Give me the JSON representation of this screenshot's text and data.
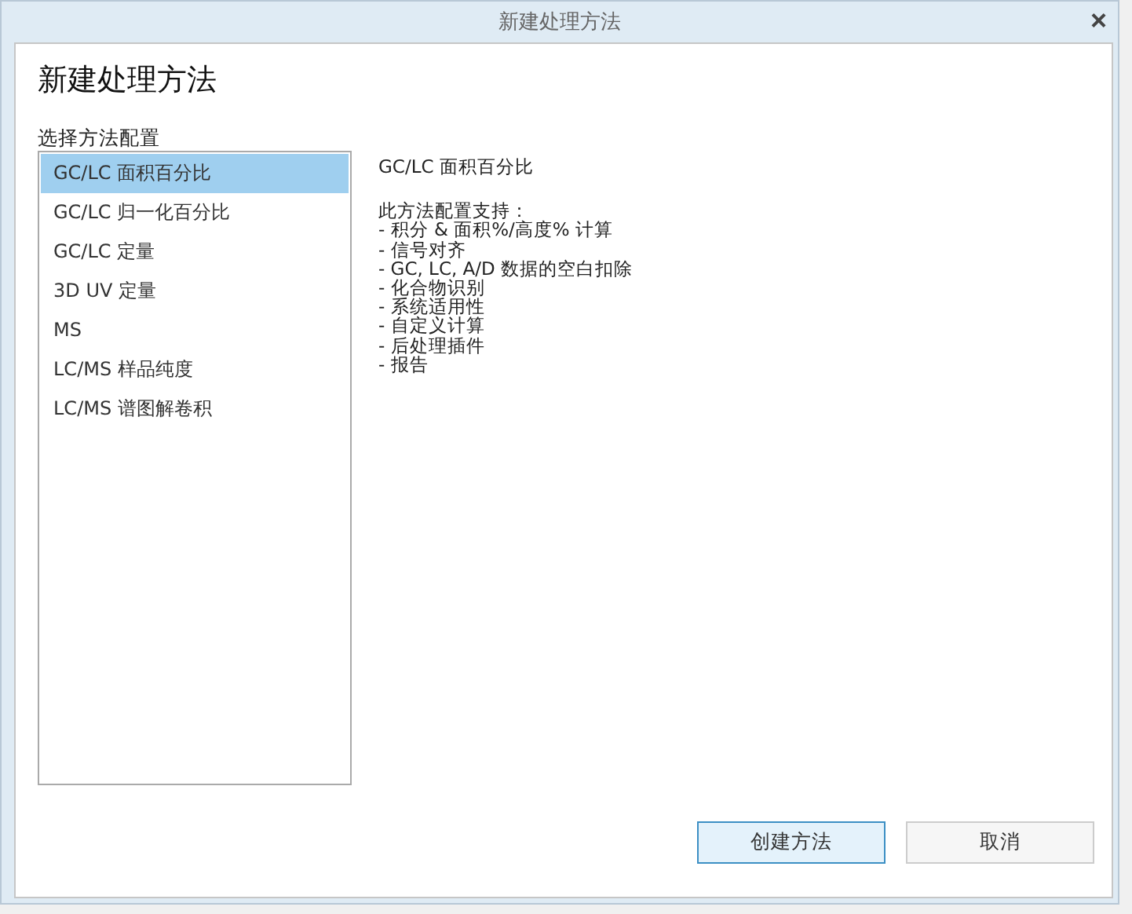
{
  "window": {
    "title": "新建处理方法",
    "close": "×"
  },
  "heading": "新建处理方法",
  "list_label": "选择方法配置",
  "configurations": [
    {
      "label": "GC/LC 面积百分比",
      "selected": true
    },
    {
      "label": "GC/LC 归一化百分比",
      "selected": false
    },
    {
      "label": "GC/LC 定量",
      "selected": false
    },
    {
      "label": "3D UV 定量",
      "selected": false
    },
    {
      "label": "MS",
      "selected": false
    },
    {
      "label": "LC/MS 样品纯度",
      "selected": false
    },
    {
      "label": "LC/MS 谱图解卷积",
      "selected": false
    }
  ],
  "details": {
    "title": "GC/LC 面积百分比",
    "intro": "此方法配置支持：",
    "features": [
      "- 积分 & 面积%/高度% 计算",
      "- 信号对齐",
      "- GC, LC, A/D 数据的空白扣除",
      "- 化合物识别",
      "- 系统适用性",
      "- 自定义计算",
      "- 后处理插件",
      "- 报告"
    ]
  },
  "buttons": [
    {
      "label": "创建方法",
      "default": true
    },
    {
      "label": "取消",
      "default": false
    }
  ]
}
